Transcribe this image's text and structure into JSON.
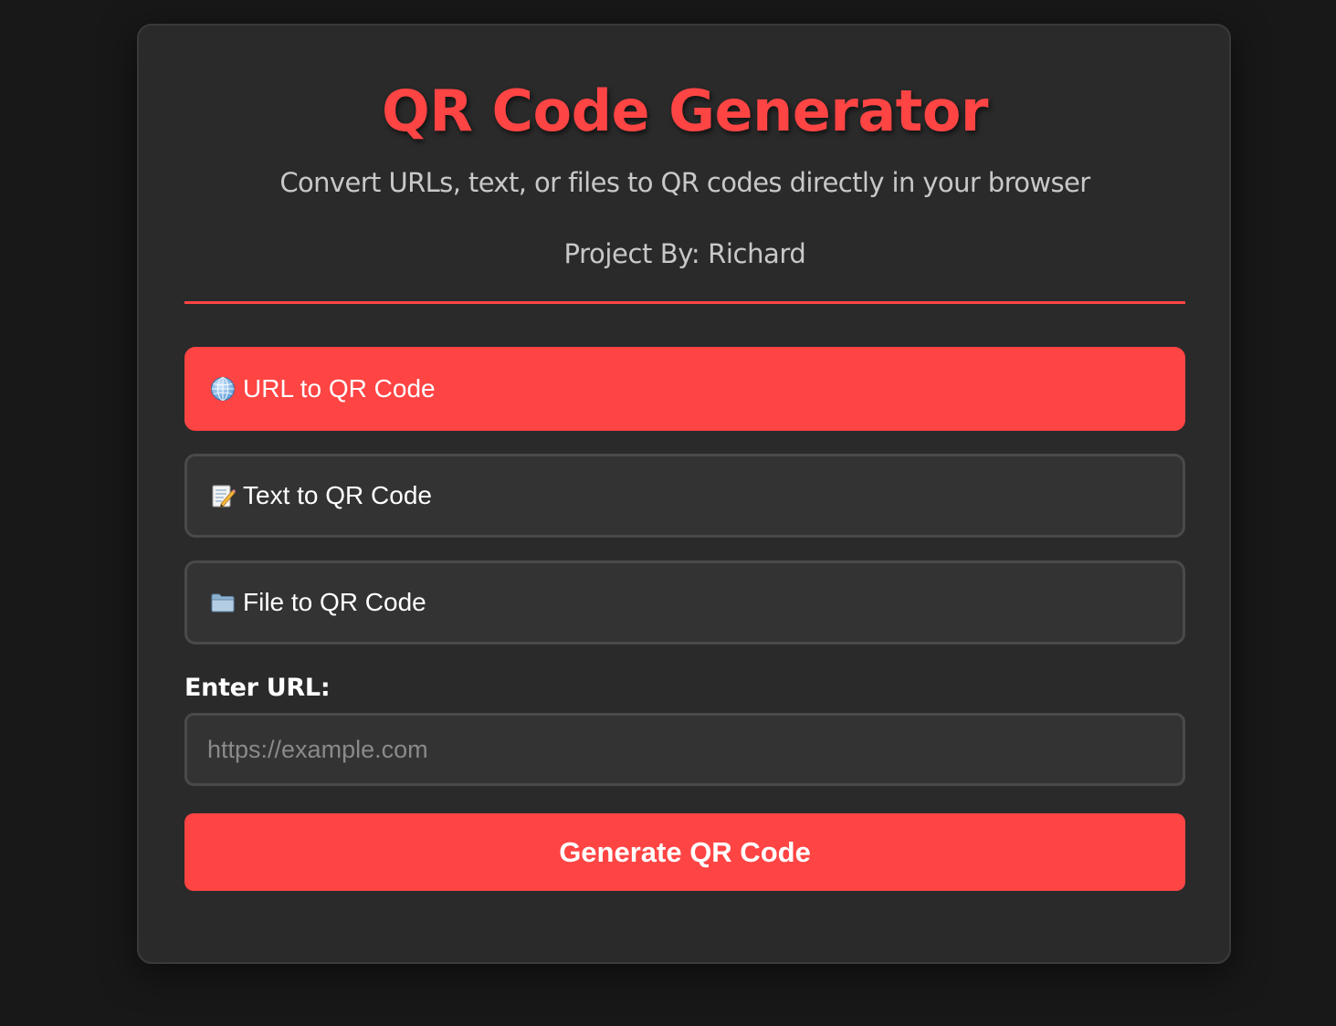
{
  "header": {
    "title": "QR Code Generator",
    "subtitle": "Convert URLs, text, or files to QR codes directly in your browser",
    "author": "Project By: Richard"
  },
  "modes": [
    {
      "label": "URL to QR Code",
      "icon": "globe-icon",
      "active": true
    },
    {
      "label": "Text to QR Code",
      "icon": "memo-icon",
      "active": false
    },
    {
      "label": "File to QR Code",
      "icon": "folder-icon",
      "active": false
    }
  ],
  "form": {
    "label": "Enter URL:",
    "value": "",
    "placeholder": "https://example.com",
    "submit_label": "Generate QR Code"
  },
  "colors": {
    "accent": "#ff4444",
    "background": "#181818",
    "card": "#2a2a2a"
  }
}
